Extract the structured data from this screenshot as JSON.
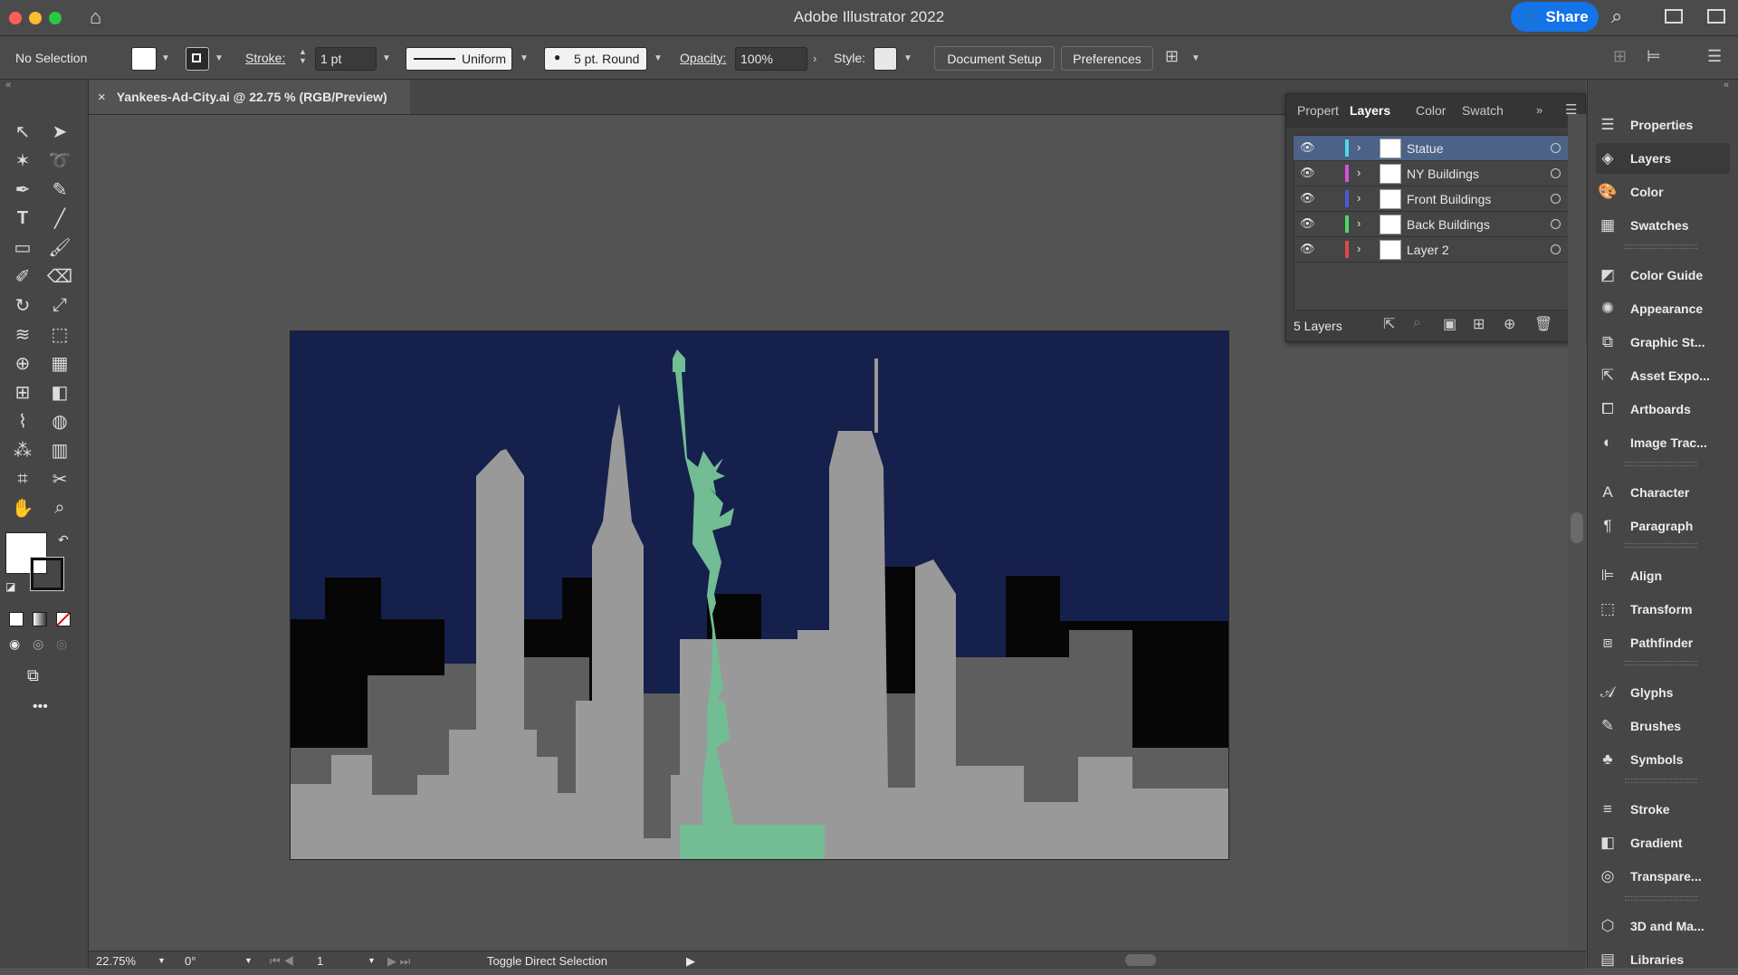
{
  "app": {
    "title": "Adobe Illustrator 2022",
    "share_label": "Share"
  },
  "control_bar": {
    "selection_label": "No Selection",
    "stroke_label": "Stroke:",
    "stroke_weight": "1 pt",
    "profile_label": "Uniform",
    "brush_label": "5 pt. Round",
    "opacity_label": "Opacity:",
    "opacity_value": "100%",
    "style_label": "Style:",
    "document_setup_label": "Document Setup",
    "preferences_label": "Preferences"
  },
  "document": {
    "tab_label": "Yankees-Ad-City.ai @ 22.75 % (RGB/Preview)"
  },
  "layers_panel": {
    "tabs": [
      "Propert",
      "Layers",
      "Color",
      "Swatch"
    ],
    "active_tab": "Layers",
    "layers": [
      {
        "name": "Statue",
        "color": "#4fd8e8",
        "selected": true
      },
      {
        "name": "NY Buildings",
        "color": "#d94fd9",
        "selected": false
      },
      {
        "name": "Front Buildings",
        "color": "#4f57d9",
        "selected": false
      },
      {
        "name": "Back Buildings",
        "color": "#4fd96a",
        "selected": false
      },
      {
        "name": "Layer 2",
        "color": "#e04848",
        "selected": false
      }
    ],
    "footer_count": "5 Layers"
  },
  "right_panel": {
    "items": [
      {
        "label": "Properties",
        "icon": "properties-icon"
      },
      {
        "label": "Layers",
        "icon": "layers-icon"
      },
      {
        "label": "Color",
        "icon": "color-icon"
      },
      {
        "label": "Swatches",
        "icon": "swatches-icon"
      },
      {
        "label": "Color Guide",
        "icon": "color-guide-icon"
      },
      {
        "label": "Appearance",
        "icon": "appearance-icon"
      },
      {
        "label": "Graphic St...",
        "icon": "graphic-styles-icon"
      },
      {
        "label": "Asset Expo...",
        "icon": "asset-export-icon"
      },
      {
        "label": "Artboards",
        "icon": "artboards-icon"
      },
      {
        "label": "Image Trac...",
        "icon": "image-trace-icon"
      },
      {
        "label": "Character",
        "icon": "character-icon"
      },
      {
        "label": "Paragraph",
        "icon": "paragraph-icon"
      },
      {
        "label": "Align",
        "icon": "align-icon"
      },
      {
        "label": "Transform",
        "icon": "transform-icon"
      },
      {
        "label": "Pathfinder",
        "icon": "pathfinder-icon"
      },
      {
        "label": "Glyphs",
        "icon": "glyphs-icon"
      },
      {
        "label": "Brushes",
        "icon": "brushes-icon"
      },
      {
        "label": "Symbols",
        "icon": "symbols-icon"
      },
      {
        "label": "Stroke",
        "icon": "stroke-icon"
      },
      {
        "label": "Gradient",
        "icon": "gradient-icon"
      },
      {
        "label": "Transpare...",
        "icon": "transparency-icon"
      },
      {
        "label": "3D and Ma...",
        "icon": "3d-materials-icon"
      },
      {
        "label": "Libraries",
        "icon": "libraries-icon"
      }
    ],
    "active": "Layers"
  },
  "status_bar": {
    "zoom": "22.75%",
    "rotation": "0°",
    "artboard_number": "1",
    "tool_hint": "Toggle Direct Selection"
  },
  "colors": {
    "sky": "#16204c",
    "statue": "#72bd94",
    "front_buildings": "#999999",
    "mid_buildings": "#5e5e5e",
    "back_buildings": "#060606",
    "accent": "#1473e6"
  }
}
